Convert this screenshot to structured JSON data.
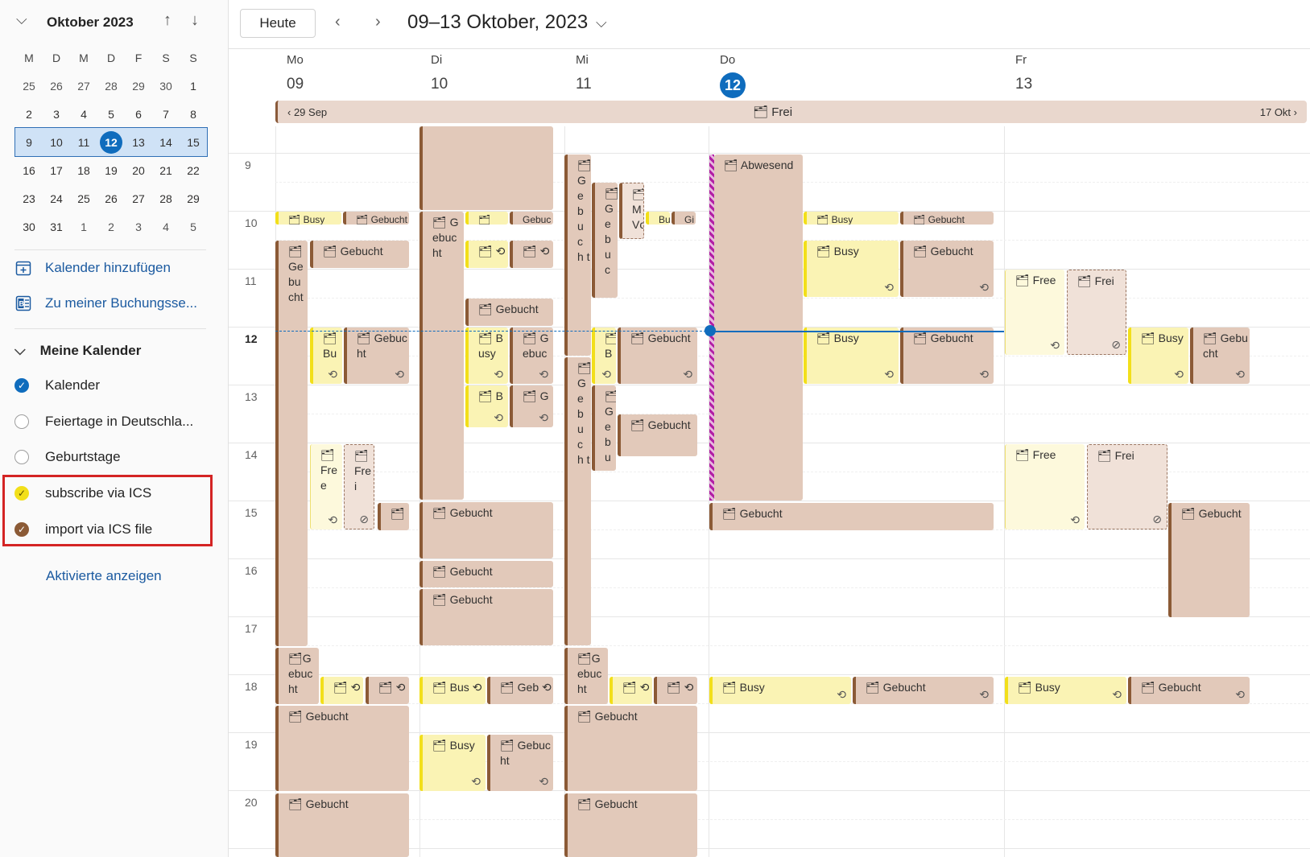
{
  "mini_calendar": {
    "month_label": "Oktober 2023",
    "weekdays": [
      "M",
      "D",
      "M",
      "D",
      "F",
      "S",
      "S"
    ],
    "weeks": [
      [
        "25",
        "26",
        "27",
        "28",
        "29",
        "30",
        "1"
      ],
      [
        "2",
        "3",
        "4",
        "5",
        "6",
        "7",
        "8"
      ],
      [
        "9",
        "10",
        "11",
        "12",
        "13",
        "14",
        "15"
      ],
      [
        "16",
        "17",
        "18",
        "19",
        "20",
        "21",
        "22"
      ],
      [
        "23",
        "24",
        "25",
        "26",
        "27",
        "28",
        "29"
      ],
      [
        "30",
        "31",
        "1",
        "2",
        "3",
        "4",
        "5"
      ]
    ],
    "today": "12"
  },
  "sidebar": {
    "add_calendar": "Kalender hinzufügen",
    "booking_page": "Zu meiner Buchungsse...",
    "my_calendars": "Meine Kalender",
    "calendars": [
      {
        "label": "Kalender",
        "color": "#0f6cbd",
        "checked": true
      },
      {
        "label": "Feiertage in Deutschla...",
        "color": "#ffffff",
        "checked": false
      },
      {
        "label": "Geburtstage",
        "color": "#ffffff",
        "checked": false
      },
      {
        "label": "subscribe via ICS",
        "color": "#f2df1a",
        "checked": true
      },
      {
        "label": "import via ICS file",
        "color": "#8b5a36",
        "checked": true
      }
    ],
    "show_active": "Aktivierte anzeigen"
  },
  "toolbar": {
    "today_button": "Heute",
    "range_title": "09–13 Oktober, 2023"
  },
  "days": [
    {
      "wd": "Mo",
      "dn": "09"
    },
    {
      "wd": "Di",
      "dn": "10"
    },
    {
      "wd": "Mi",
      "dn": "11"
    },
    {
      "wd": "Do",
      "dn": "12"
    },
    {
      "wd": "Fr",
      "dn": "13"
    }
  ],
  "allday": {
    "left": "29 Sep",
    "center": "Frei",
    "right": "17 Okt"
  },
  "hours": [
    "9",
    "10",
    "11",
    "12",
    "13",
    "14",
    "15",
    "16",
    "17",
    "18",
    "19",
    "20"
  ],
  "events": {
    "gebucht": "Gebucht",
    "busy": "Busy",
    "free": "Free",
    "frei": "Frei",
    "abwesend": "Abwesend",
    "ge_bu_cht": "Ge bu cht",
    "g_ebuc_ht": "G ebuc ht",
    "gebuc_ht": "Gebuc ht",
    "gebu_cht": "Gebu cht",
    "b_usy": "B usy",
    "bu": "Bu",
    "fre_e": "Fre e",
    "fre_i": "Fre i",
    "g_ebuc": "G ebuc",
    "b": "B",
    "g": "G",
    "bus": "Bus",
    "geb": "Geb",
    "gebuc": "Gebuc",
    "m_vc": "M Vc",
    "g_e_b_u_c_h_t": "G e b u c h t",
    "g_e_b_u_c": "G e b u c",
    "g_e_b_u": "G e b u",
    "bu_small": "Bu",
    "g_small": "Gi"
  }
}
